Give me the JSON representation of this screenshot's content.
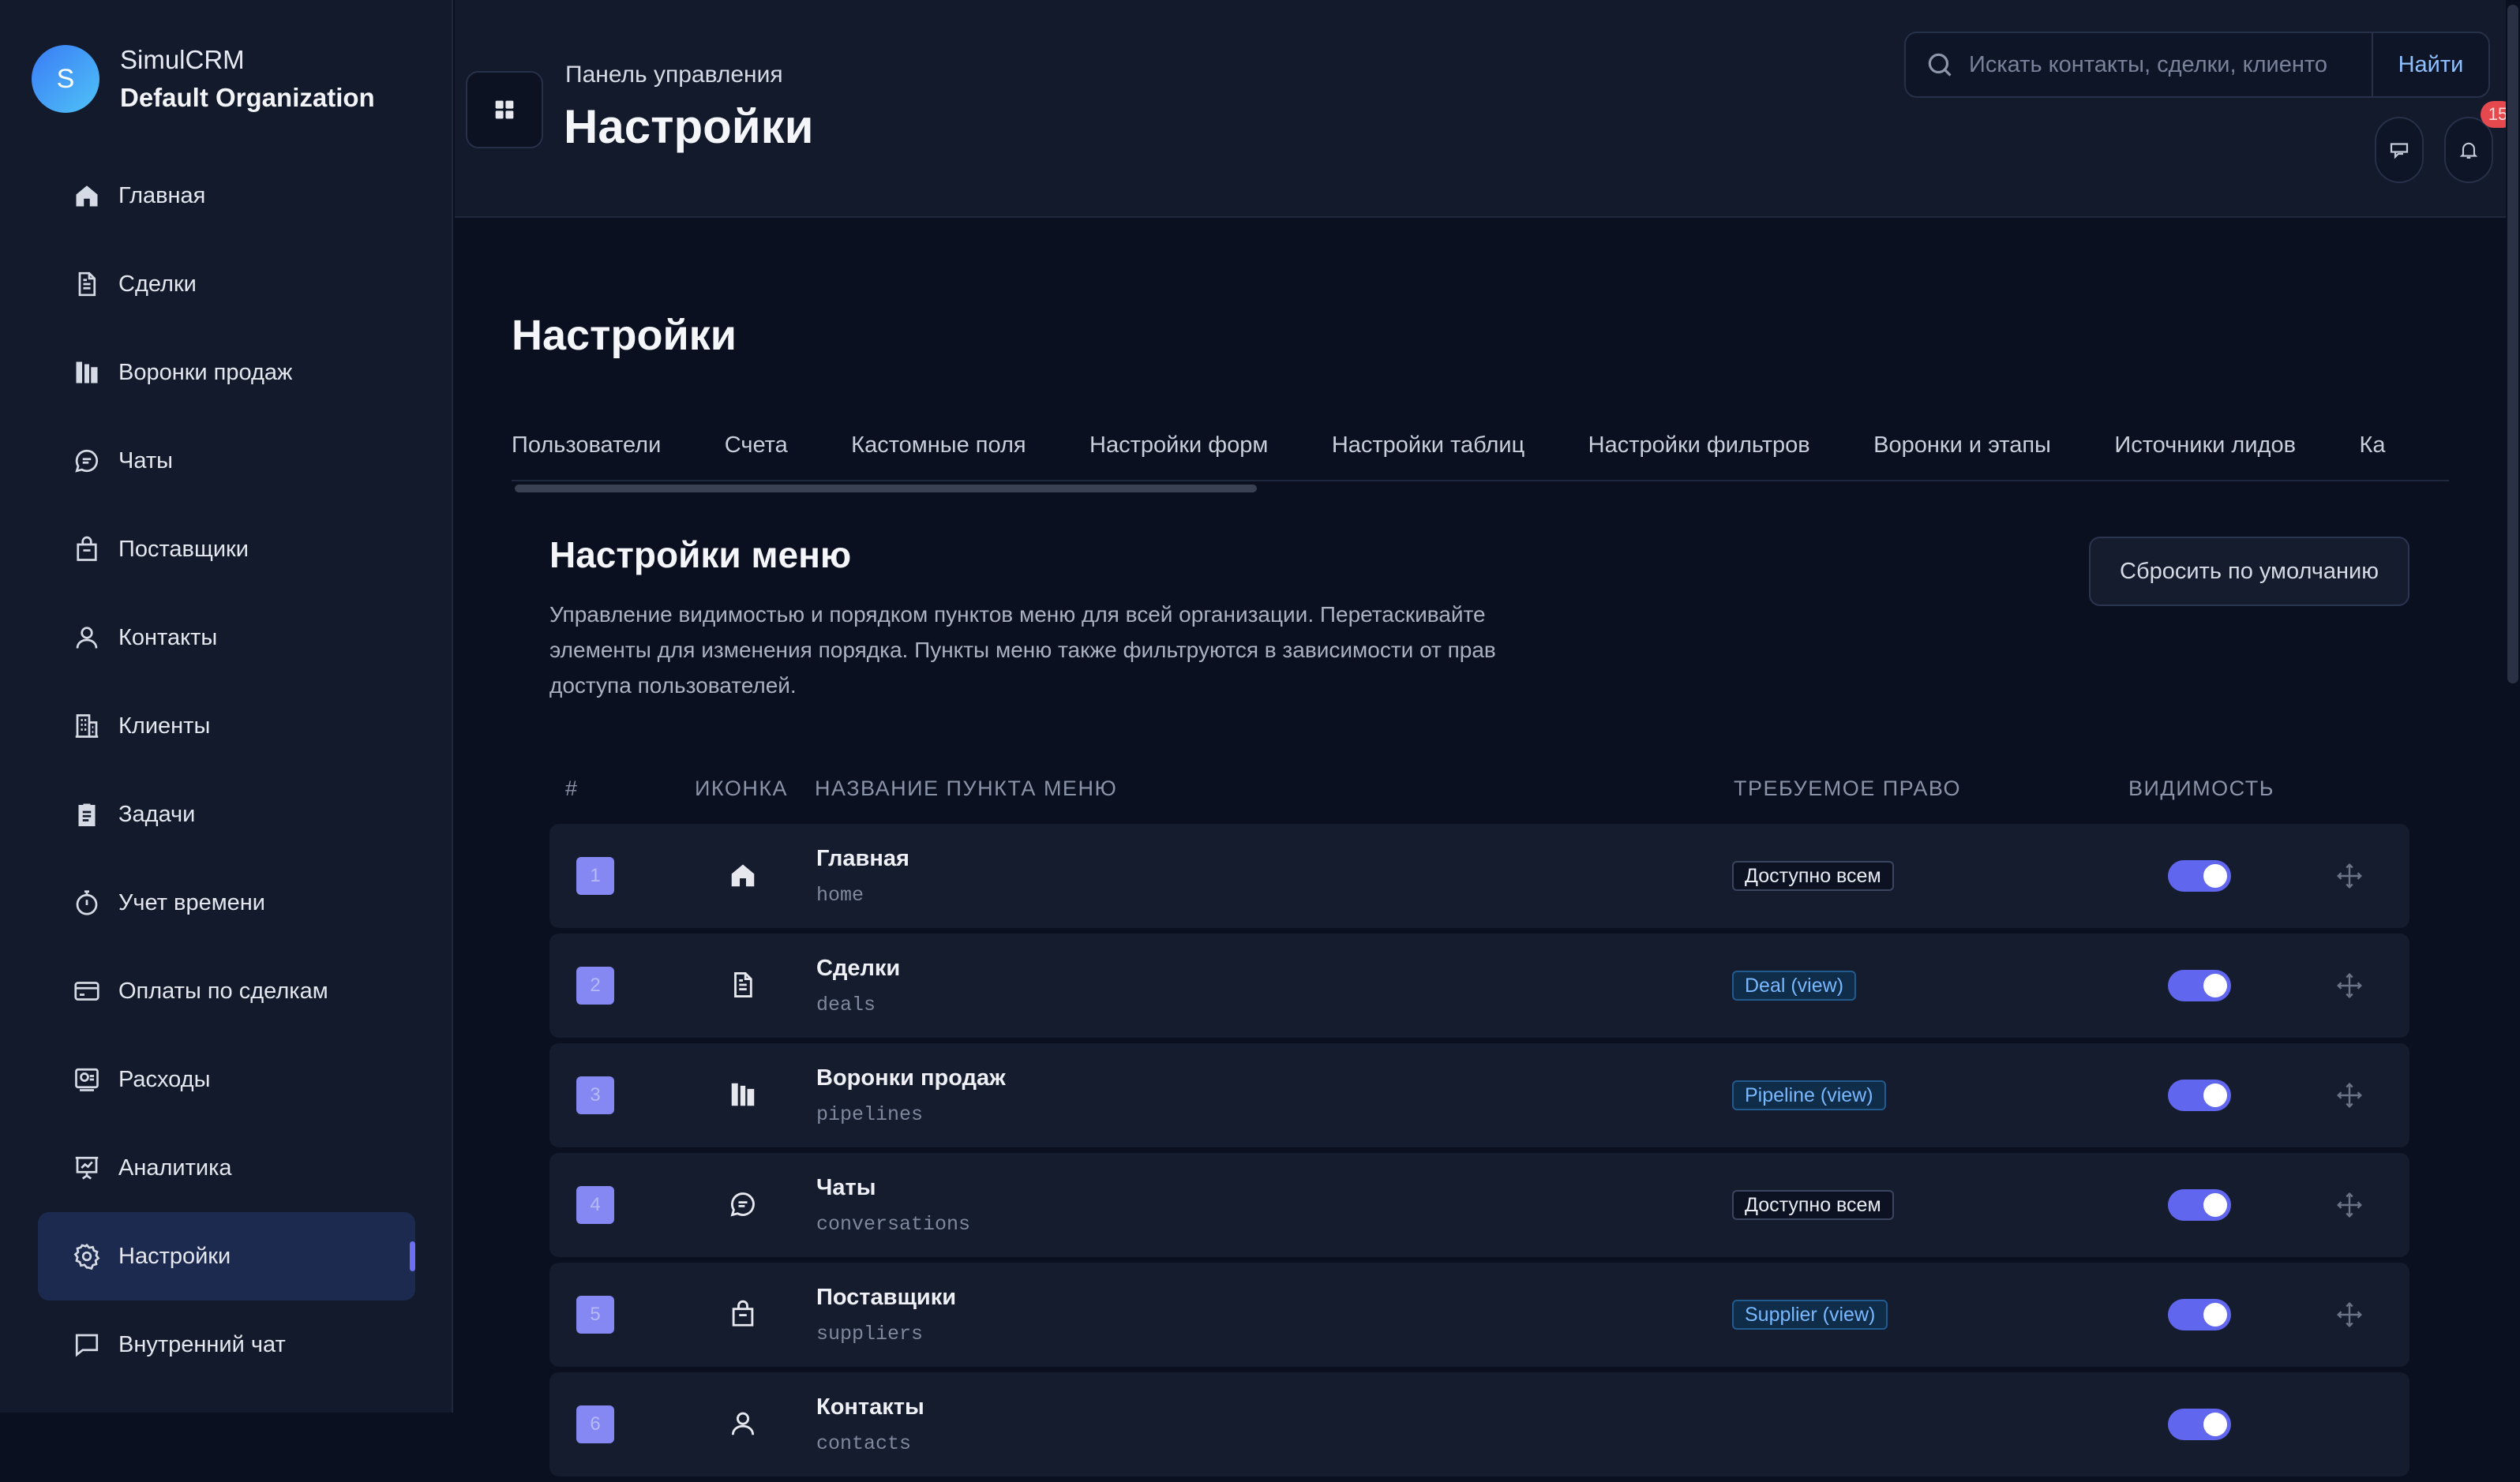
{
  "brand": {
    "avatar_letter": "S",
    "app_name": "SimulCRM",
    "org_name": "Default Organization"
  },
  "sidebar": {
    "items": [
      {
        "label": "Главная",
        "icon": "home-icon"
      },
      {
        "label": "Сделки",
        "icon": "document-icon"
      },
      {
        "label": "Воронки продаж",
        "icon": "pipeline-icon"
      },
      {
        "label": "Чаты",
        "icon": "chat-icon"
      },
      {
        "label": "Поставщики",
        "icon": "shopping-bag-icon"
      },
      {
        "label": "Контакты",
        "icon": "user-icon"
      },
      {
        "label": "Клиенты",
        "icon": "building-icon"
      },
      {
        "label": "Задачи",
        "icon": "clipboard-icon"
      },
      {
        "label": "Учет времени",
        "icon": "stopwatch-icon"
      },
      {
        "label": "Оплаты по сделкам",
        "icon": "credit-card-icon"
      },
      {
        "label": "Расходы",
        "icon": "receipt-icon"
      },
      {
        "label": "Аналитика",
        "icon": "presentation-chart-icon"
      },
      {
        "label": "Настройки",
        "icon": "gear-icon",
        "active": true
      },
      {
        "label": "Внутренний чат",
        "icon": "message-square-icon"
      }
    ]
  },
  "header": {
    "breadcrumb": "Панель управления",
    "title": "Настройки",
    "search_placeholder": "Искать контакты, сделки, клиенто",
    "search_button": "Найти",
    "notification_count": "15"
  },
  "content": {
    "title": "Настройки",
    "tabs": [
      "Пользователи",
      "Счета",
      "Кастомные поля",
      "Настройки форм",
      "Настройки таблиц",
      "Настройки фильтров",
      "Воронки и этапы",
      "Источники лидов",
      "Ка"
    ]
  },
  "menu_settings": {
    "title": "Настройки меню",
    "description": "Управление видимостью и порядком пунктов меню для всей организации. Перетаскивайте элементы для изменения порядка. Пункты меню также фильтруются в зависимости от прав доступа пользователей.",
    "reset_button": "Сбросить по умолчанию",
    "columns": {
      "num": "#",
      "icon": "ИКОНКА",
      "name": "НАЗВАНИЕ ПУНКТА МЕНЮ",
      "permission": "ТРЕБУЕМОЕ ПРАВО",
      "visibility": "ВИДИМОСТЬ"
    },
    "rows": [
      {
        "num": "1",
        "name": "Главная",
        "key": "home",
        "permission": "Доступно всем",
        "permission_type": "all",
        "visible": true,
        "icon": "home-icon"
      },
      {
        "num": "2",
        "name": "Сделки",
        "key": "deals",
        "permission": "Deal (view)",
        "permission_type": "specific",
        "visible": true,
        "icon": "document-icon"
      },
      {
        "num": "3",
        "name": "Воронки продаж",
        "key": "pipelines",
        "permission": "Pipeline (view)",
        "permission_type": "specific",
        "visible": true,
        "icon": "pipeline-icon"
      },
      {
        "num": "4",
        "name": "Чаты",
        "key": "conversations",
        "permission": "Доступно всем",
        "permission_type": "all",
        "visible": true,
        "icon": "chat-icon"
      },
      {
        "num": "5",
        "name": "Поставщики",
        "key": "suppliers",
        "permission": "Supplier (view)",
        "permission_type": "specific",
        "visible": true,
        "icon": "shopping-bag-icon"
      },
      {
        "num": "6",
        "name": "Контакты",
        "key": "contacts",
        "permission": "",
        "permission_type": "specific",
        "visible": true,
        "icon": "user-icon"
      }
    ]
  },
  "colors": {
    "accent": "#6166ee",
    "background": "#0b1020",
    "sidebar": "#121a2c",
    "active_item": "#1d2a4f",
    "badge": "#e5484d"
  }
}
